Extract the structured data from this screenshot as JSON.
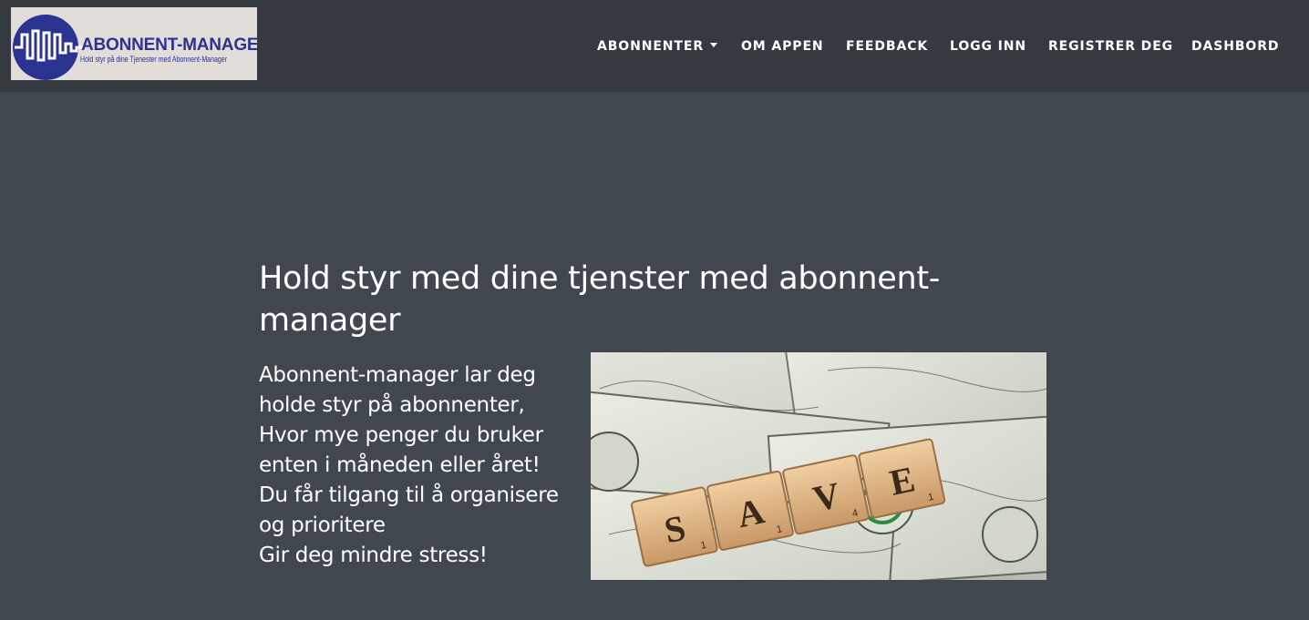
{
  "brand": {
    "logo_title": "ABONNENT-MANAGER",
    "logo_subtitle": "Hold styr på dine Tjenester med Abonnent-Manager",
    "color": "#2b3390"
  },
  "nav": {
    "items": [
      {
        "label": "ABONNENTER",
        "dropdown": true
      },
      {
        "label": "OM APPEN"
      },
      {
        "label": "FEEDBACK"
      },
      {
        "label": "LOGG INN"
      },
      {
        "label": "REGISTRER DEG"
      },
      {
        "label": "DASHBORD"
      }
    ]
  },
  "hero": {
    "title": "Hold styr med dine tjenster med abonnent-manager",
    "lines": [
      "Abonnent-manager lar deg",
      "holde styr på abonnenter,",
      "Hvor mye penger du bruker",
      "enten i måneden eller året!",
      "Du får tilgang til å organisere",
      "og prioritere",
      "Gir deg mindre stress!"
    ],
    "image": {
      "tiles": [
        "S",
        "A",
        "V",
        "E"
      ],
      "tile_scores": [
        "1",
        "1",
        "4",
        "1"
      ]
    }
  },
  "colors": {
    "navbar": "#343a40",
    "background": "#40474f",
    "text": "#ffffff"
  }
}
